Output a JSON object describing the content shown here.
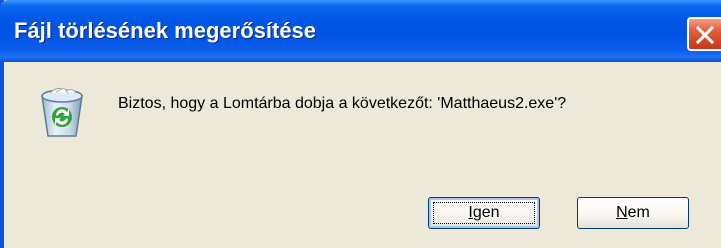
{
  "window": {
    "title": "Fájl törlésének megerősítése"
  },
  "title_bar": {
    "close_icon": "close-x-icon"
  },
  "dialog": {
    "icon": "recycle-bin-icon",
    "message": "Biztos, hogy a Lomtárba dobja a következőt: 'Matthaeus2.exe'?"
  },
  "buttons": {
    "yes": {
      "accel": "I",
      "rest": "gen"
    },
    "no": {
      "accel": "N",
      "rest": "em"
    }
  },
  "colors": {
    "title_bar": "#0054E3",
    "close_button": "#D24A26",
    "dialog_background": "#ECE9D8",
    "button_border": "#003C74"
  }
}
